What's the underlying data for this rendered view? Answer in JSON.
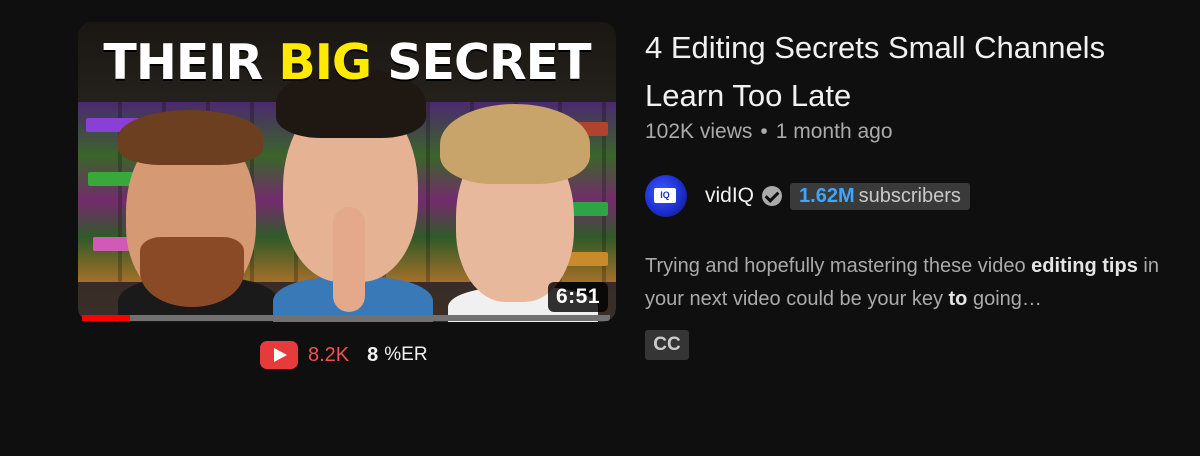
{
  "video": {
    "thumbnail": {
      "headline_parts": [
        "THEIR",
        "BIG",
        "SECRET"
      ],
      "headline_highlight_color": "#ffea00",
      "duration": "6:51",
      "watch_progress": 0.09
    },
    "title": "4 Editing Secrets Small Channels Learn Too Late",
    "views": "102K views",
    "separator": "•",
    "age": "1 month ago",
    "description": {
      "segments": [
        {
          "text": "Trying and hopefully mastering these video ",
          "bold": false
        },
        {
          "text": "editing",
          "bold": true
        },
        {
          "text": " ",
          "bold": false
        },
        {
          "text": "tips",
          "bold": true
        },
        {
          "text": " in your next video could be your key ",
          "bold": false
        },
        {
          "text": "to",
          "bold": true
        },
        {
          "text": " going…",
          "bold": false
        }
      ]
    },
    "badge": "CC"
  },
  "channel": {
    "avatar_text": "IQ",
    "name": "vidIQ",
    "verified": true,
    "subscriber_count": "1.62M",
    "subscriber_label": "subscribers"
  },
  "stats": {
    "youtube_icon": "youtube-play-icon",
    "likes": "8.2K",
    "er_value": "8",
    "er_label": "%ER"
  },
  "colors": {
    "background": "#0f0f0f",
    "accent_red": "#ff0000",
    "subscriber_blue": "#3ea6ff"
  }
}
